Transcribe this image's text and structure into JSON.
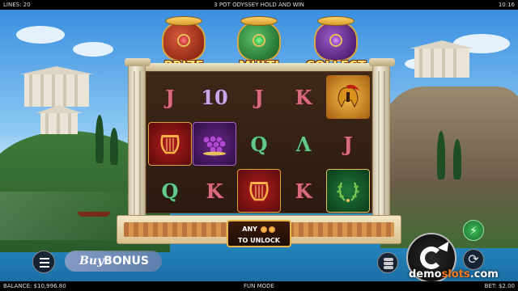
{
  "topbar": {
    "lines": "LINES: 20",
    "title": "3 POT ODYSSEY HOLD AND WIN",
    "clock": "10:16"
  },
  "pots": [
    {
      "label": "PRIZE",
      "color": "#b8321f",
      "gem": "#e03030"
    },
    {
      "label": "MULTI",
      "color": "#2f8a3a",
      "gem": "#2cd04a"
    },
    {
      "label": "COLLECT",
      "color": "#6a2a9a",
      "gem": "#a040e0"
    }
  ],
  "reels": [
    [
      {
        "text": "",
        "icon": "lyre-icon"
      },
      {
        "text": "J"
      },
      {
        "text": "Q"
      }
    ],
    [
      {
        "text": "10"
      },
      {
        "text": "",
        "icon": "grapes-icon"
      },
      {
        "text": "K"
      }
    ],
    [
      {
        "text": "J"
      },
      {
        "text": "Q"
      },
      {
        "text": "",
        "icon": "lyre-icon"
      }
    ],
    [
      {
        "text": "K"
      },
      {
        "text": "Λ"
      },
      {
        "text": "K"
      }
    ],
    [
      {
        "text": "",
        "icon": "helmet-icon"
      },
      {
        "text": "J"
      },
      {
        "text": "",
        "icon": "laurel-icon"
      }
    ]
  ],
  "unlock": {
    "line1": "ANY",
    "line2": "TO UNLOCK"
  },
  "controls": {
    "buy_label": "Buy",
    "bonus_label": "BONUS",
    "turbo_icon": "lightning-icon",
    "auto_icon": "autoplay-icon"
  },
  "watermark": {
    "part1": "demo",
    "dot": "slots",
    "part2": ".com"
  },
  "bottombar": {
    "balance": "BALANCE: $10,996.80",
    "mode": "FUN MODE",
    "bet": "BET: $2.00"
  }
}
